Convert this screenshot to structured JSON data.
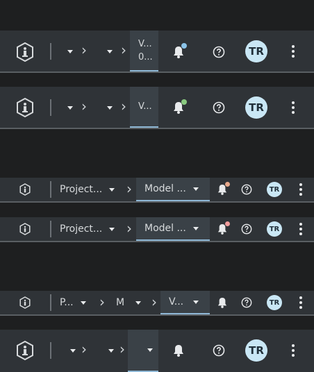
{
  "colors": {
    "bar_bg": "#2f3337",
    "active_segment_bg": "#3a4147",
    "active_underline": "#8fb8d6",
    "dot_blue": "#8bc3e8",
    "dot_green": "#89c97f",
    "dot_orange": "#e7a88b",
    "dot_red": "#f09c9c",
    "avatar_bg": "#c9e7f5"
  },
  "icons": [
    "info-logo-icon",
    "chevron-right-icon",
    "caret-down-icon",
    "bell-icon",
    "help-icon",
    "kebab-menu-icon"
  ],
  "user": {
    "initials": "TR"
  },
  "bar1": {
    "active_line1": "V...",
    "active_line2": "0..."
  },
  "bar2": {
    "active_label": "V..."
  },
  "bar3": {
    "project_label": "Project...",
    "model_label": "Model ..."
  },
  "bar4": {
    "project_label": "Project...",
    "model_label": "Model ..."
  },
  "bar5": {
    "project_label": "P...",
    "model_label": "M",
    "version_label": "V..."
  }
}
